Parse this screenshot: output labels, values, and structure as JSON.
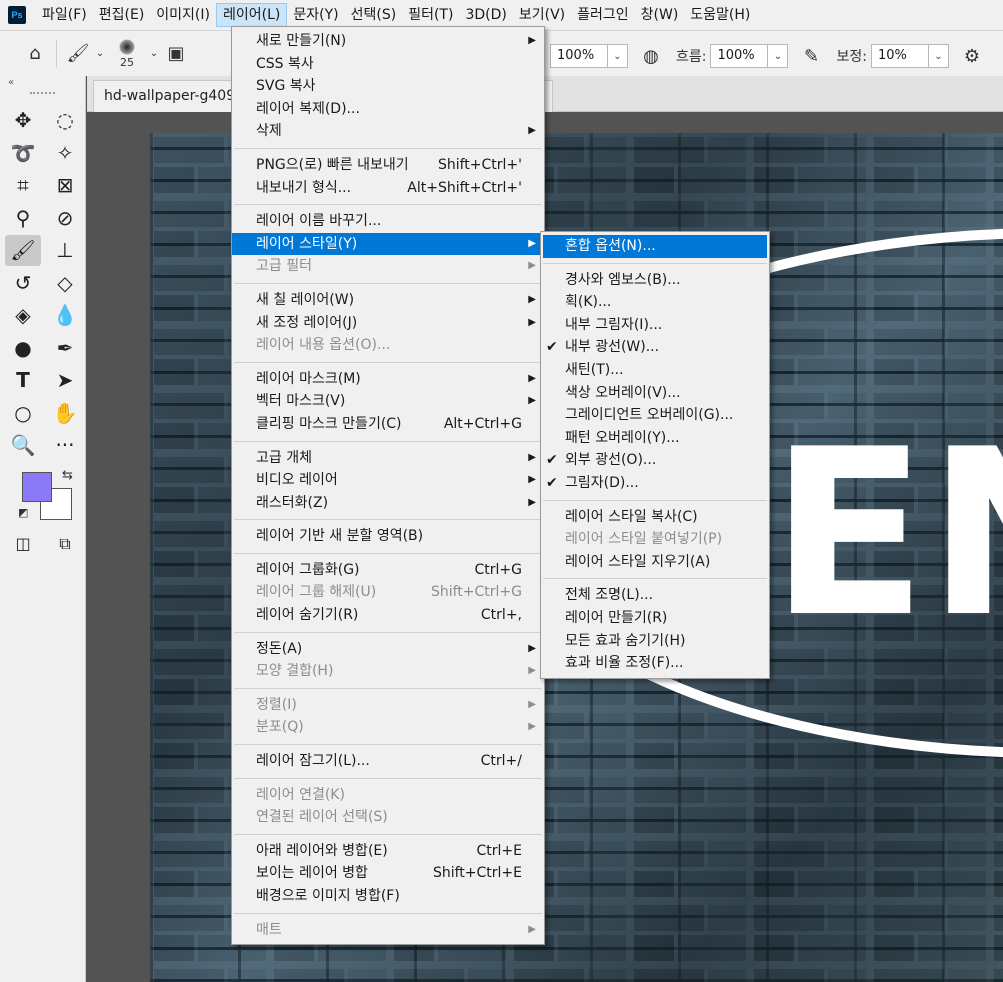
{
  "app": {
    "logo": "Ps"
  },
  "menubar": {
    "items": [
      "파일(F)",
      "편집(E)",
      "이미지(I)",
      "레이어(L)",
      "문자(Y)",
      "선택(S)",
      "필터(T)",
      "3D(D)",
      "보기(V)",
      "플러그인",
      "창(W)",
      "도움말(H)"
    ]
  },
  "options": {
    "brush_size": "25",
    "opacity_value": "100%",
    "flow_label": "흐름:",
    "flow_value": "100%",
    "smoothing_label": "보정:",
    "smoothing_value": "10%"
  },
  "document": {
    "tab_title": "hd-wallpaper-g409"
  },
  "colors": {
    "foreground": "#8a7af6",
    "background": "#ffffff",
    "highlight": "#0078d7"
  },
  "layer_menu": {
    "items": [
      {
        "label": "새로 만들기(N)",
        "shortcut": "",
        "arrow": true,
        "disabled": false
      },
      {
        "label": "CSS 복사",
        "shortcut": "",
        "arrow": false,
        "disabled": false
      },
      {
        "label": "SVG 복사",
        "shortcut": "",
        "arrow": false,
        "disabled": false
      },
      {
        "label": "레이어 복제(D)...",
        "shortcut": "",
        "arrow": false,
        "disabled": false
      },
      {
        "label": "삭제",
        "shortcut": "",
        "arrow": true,
        "disabled": false
      },
      {
        "sep": true
      },
      {
        "label": "PNG으(로) 빠른 내보내기",
        "shortcut": "Shift+Ctrl+'",
        "arrow": false,
        "disabled": false
      },
      {
        "label": "내보내기 형식...",
        "shortcut": "Alt+Shift+Ctrl+'",
        "arrow": false,
        "disabled": false
      },
      {
        "sep": true
      },
      {
        "label": "레이어 이름 바꾸기...",
        "shortcut": "",
        "arrow": false,
        "disabled": false
      },
      {
        "label": "레이어 스타일(Y)",
        "shortcut": "",
        "arrow": true,
        "disabled": false,
        "highlighted": true
      },
      {
        "label": "고급 필터",
        "shortcut": "",
        "arrow": true,
        "disabled": true
      },
      {
        "sep": true
      },
      {
        "label": "새 칠 레이어(W)",
        "shortcut": "",
        "arrow": true,
        "disabled": false
      },
      {
        "label": "새 조정 레이어(J)",
        "shortcut": "",
        "arrow": true,
        "disabled": false
      },
      {
        "label": "레이어 내용 옵션(O)...",
        "shortcut": "",
        "arrow": false,
        "disabled": true
      },
      {
        "sep": true
      },
      {
        "label": "레이어 마스크(M)",
        "shortcut": "",
        "arrow": true,
        "disabled": false
      },
      {
        "label": "벡터 마스크(V)",
        "shortcut": "",
        "arrow": true,
        "disabled": false
      },
      {
        "label": "클리핑 마스크 만들기(C)",
        "shortcut": "Alt+Ctrl+G",
        "arrow": false,
        "disabled": false
      },
      {
        "sep": true
      },
      {
        "label": "고급 개체",
        "shortcut": "",
        "arrow": true,
        "disabled": false
      },
      {
        "label": "비디오 레이어",
        "shortcut": "",
        "arrow": true,
        "disabled": false
      },
      {
        "label": "래스터화(Z)",
        "shortcut": "",
        "arrow": true,
        "disabled": false
      },
      {
        "sep": true
      },
      {
        "label": "레이어 기반 새 분할 영역(B)",
        "shortcut": "",
        "arrow": false,
        "disabled": false
      },
      {
        "sep": true
      },
      {
        "label": "레이어 그룹화(G)",
        "shortcut": "Ctrl+G",
        "arrow": false,
        "disabled": false
      },
      {
        "label": "레이어 그룹 해제(U)",
        "shortcut": "Shift+Ctrl+G",
        "arrow": false,
        "disabled": true
      },
      {
        "label": "레이어 숨기기(R)",
        "shortcut": "Ctrl+,",
        "arrow": false,
        "disabled": false
      },
      {
        "sep": true
      },
      {
        "label": "정돈(A)",
        "shortcut": "",
        "arrow": true,
        "disabled": false
      },
      {
        "label": "모양 결합(H)",
        "shortcut": "",
        "arrow": true,
        "disabled": true
      },
      {
        "sep": true
      },
      {
        "label": "정렬(I)",
        "shortcut": "",
        "arrow": true,
        "disabled": true
      },
      {
        "label": "분포(Q)",
        "shortcut": "",
        "arrow": true,
        "disabled": true
      },
      {
        "sep": true
      },
      {
        "label": "레이어 잠그기(L)...",
        "shortcut": "Ctrl+/",
        "arrow": false,
        "disabled": false
      },
      {
        "sep": true
      },
      {
        "label": "레이어 연결(K)",
        "shortcut": "",
        "arrow": false,
        "disabled": true
      },
      {
        "label": "연결된 레이어 선택(S)",
        "shortcut": "",
        "arrow": false,
        "disabled": true
      },
      {
        "sep": true
      },
      {
        "label": "아래 레이어와 병합(E)",
        "shortcut": "Ctrl+E",
        "arrow": false,
        "disabled": false
      },
      {
        "label": "보이는 레이어 병합",
        "shortcut": "Shift+Ctrl+E",
        "arrow": false,
        "disabled": false
      },
      {
        "label": "배경으로 이미지 병합(F)",
        "shortcut": "",
        "arrow": false,
        "disabled": false
      },
      {
        "sep": true
      },
      {
        "label": "매트",
        "shortcut": "",
        "arrow": true,
        "disabled": true
      }
    ]
  },
  "style_submenu": {
    "items": [
      {
        "label": "혼합 옵션(N)...",
        "checked": false,
        "disabled": false,
        "highlighted": true
      },
      {
        "sep": true
      },
      {
        "label": "경사와 엠보스(B)...",
        "checked": false,
        "disabled": false
      },
      {
        "label": "획(K)...",
        "checked": false,
        "disabled": false
      },
      {
        "label": "내부 그림자(I)...",
        "checked": false,
        "disabled": false
      },
      {
        "label": "내부 광선(W)...",
        "checked": true,
        "disabled": false
      },
      {
        "label": "새틴(T)...",
        "checked": false,
        "disabled": false
      },
      {
        "label": "색상 오버레이(V)...",
        "checked": false,
        "disabled": false
      },
      {
        "label": "그레이디언트 오버레이(G)...",
        "checked": false,
        "disabled": false
      },
      {
        "label": "패턴 오버레이(Y)...",
        "checked": false,
        "disabled": false
      },
      {
        "label": "외부 광선(O)...",
        "checked": true,
        "disabled": false
      },
      {
        "label": "그림자(D)...",
        "checked": true,
        "disabled": false
      },
      {
        "sep": true
      },
      {
        "label": "레이어 스타일 복사(C)",
        "checked": false,
        "disabled": false
      },
      {
        "label": "레이어 스타일 붙여넣기(P)",
        "checked": false,
        "disabled": true
      },
      {
        "label": "레이어 스타일 지우기(A)",
        "checked": false,
        "disabled": false
      },
      {
        "sep": true
      },
      {
        "label": "전체 조명(L)...",
        "checked": false,
        "disabled": false
      },
      {
        "label": "레이어 만들기(R)",
        "checked": false,
        "disabled": false
      },
      {
        "label": "모든 효과 숨기기(H)",
        "checked": false,
        "disabled": false
      },
      {
        "label": "효과 비율 조정(F)...",
        "checked": false,
        "disabled": false
      }
    ]
  },
  "canvas_text": "EN"
}
